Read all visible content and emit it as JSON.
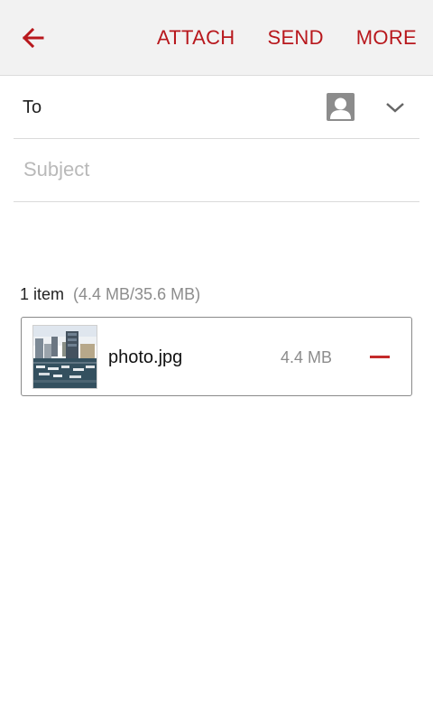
{
  "colors": {
    "accent": "#b8181d",
    "toolbar_bg": "#f2f2f2",
    "remove": "#c42a2a"
  },
  "toolbar": {
    "back_icon": "arrow-left-icon",
    "attach_label": "ATTACH",
    "send_label": "SEND",
    "more_label": "MORE"
  },
  "compose": {
    "to_label": "To",
    "contact_icon": "contact-person-icon",
    "expand_icon": "chevron-down-icon",
    "subject_placeholder": "Subject"
  },
  "attachments": {
    "count_label": "1 item",
    "size_summary": "(4.4 MB/35.6 MB)",
    "items": [
      {
        "name": "photo.jpg",
        "size": "4.4 MB",
        "thumbnail": "harbor-marina-photo",
        "remove_icon": "minus-icon"
      }
    ]
  }
}
